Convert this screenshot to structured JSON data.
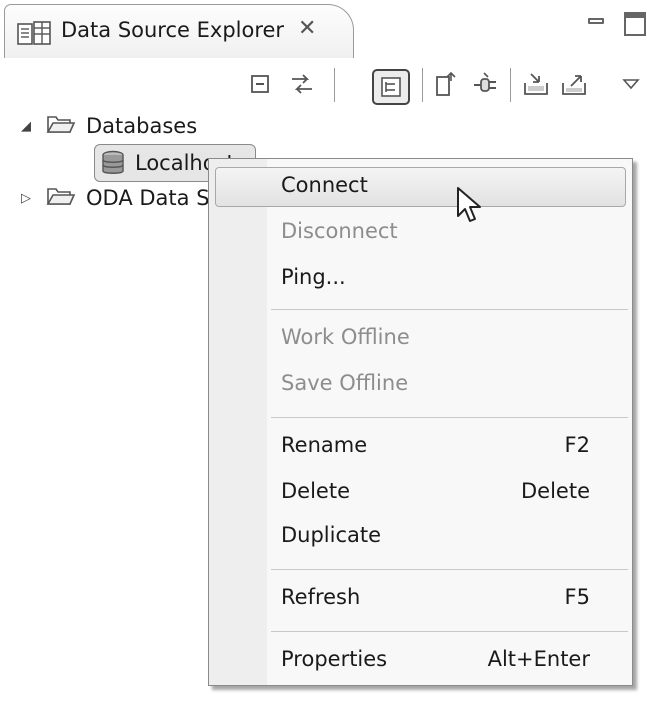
{
  "view": {
    "title": "Data Source Explorer",
    "close_glyph": "✕"
  },
  "toolbar": {
    "buttons": [
      {
        "icon": "collapse-all-icon"
      },
      {
        "icon": "link-with-editor-icon"
      },
      {
        "icon": "flat-layout-icon",
        "pressed": true
      },
      {
        "icon": "new-connection-profile-icon"
      },
      {
        "icon": "connect-icon"
      },
      {
        "icon": "import-icon"
      },
      {
        "icon": "export-icon"
      },
      {
        "icon": "view-menu-icon"
      }
    ]
  },
  "tree": {
    "databases_label": "Databases",
    "localhost_label": "Localhost",
    "oda_label": "ODA Data Sources"
  },
  "menu": {
    "connect": "Connect",
    "disconnect": "Disconnect",
    "ping": "Ping...",
    "work_offline": "Work Offline",
    "save_offline": "Save Offline",
    "rename": "Rename",
    "rename_accel": "F2",
    "delete": "Delete",
    "delete_accel": "Delete",
    "duplicate": "Duplicate",
    "refresh": "Refresh",
    "refresh_accel": "F5",
    "properties": "Properties",
    "properties_accel": "Alt+Enter"
  }
}
